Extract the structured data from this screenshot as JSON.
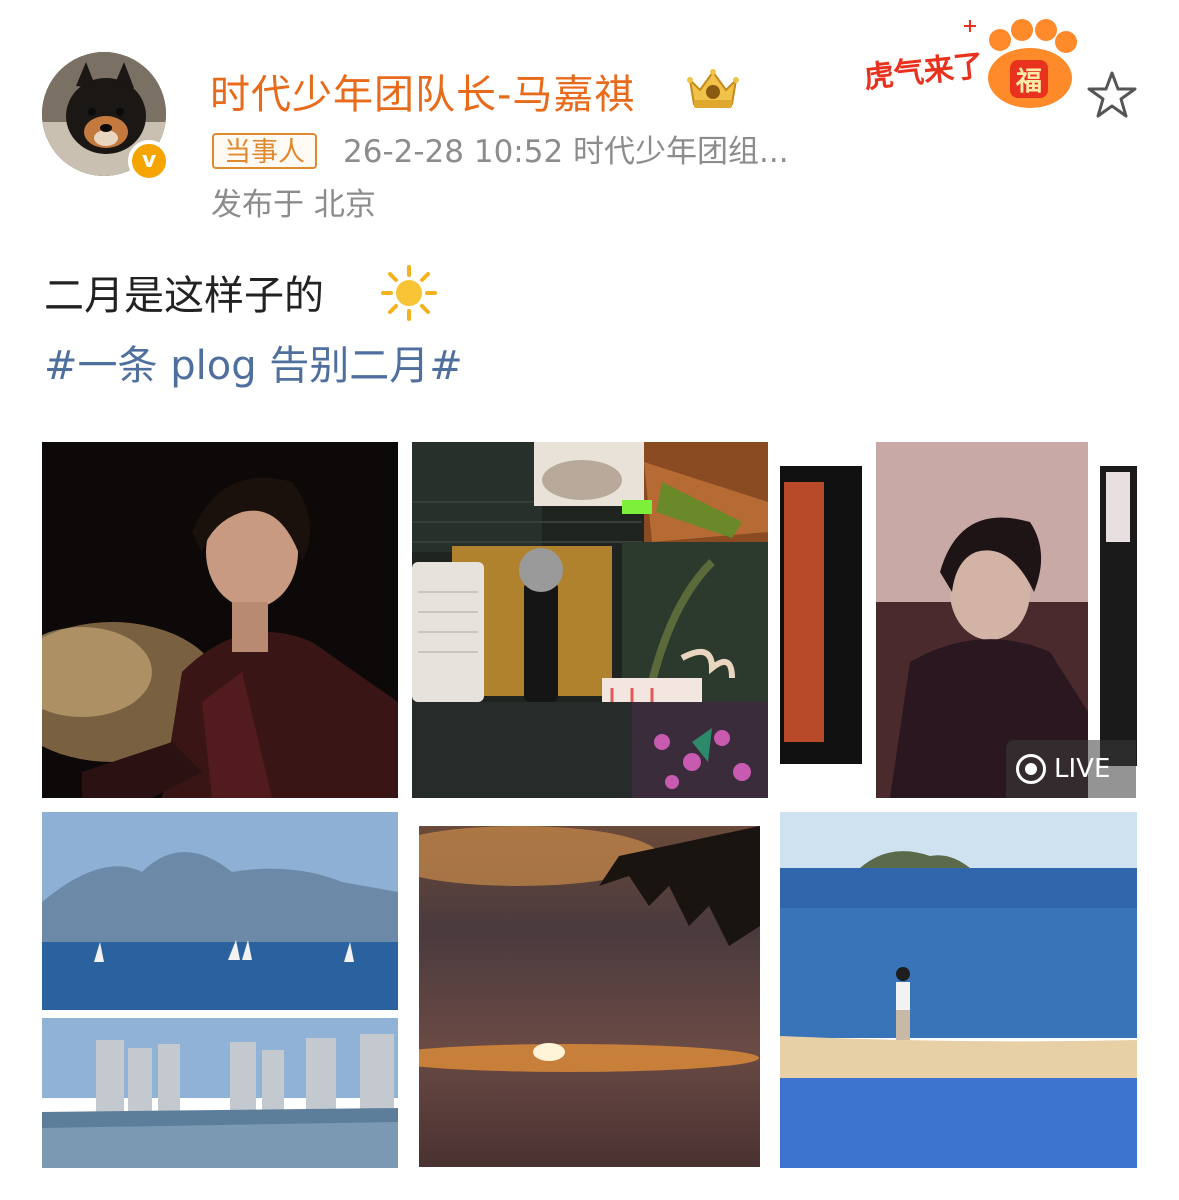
{
  "header": {
    "username": "时代少年团队长-马嘉祺",
    "verified": "v",
    "tag": "当事人",
    "meta": "26-2-28 10:52  时代少年团组...",
    "location": "发布于 北京",
    "event_badge_text": "虎气来了",
    "event_badge_char": "福"
  },
  "post": {
    "text": "二月是这样子的",
    "hashtag": "#一条 plog 告别二月#"
  },
  "grid": {
    "live_label": "LIVE",
    "photos": [
      "portrait-leather-jacket-smoke",
      "collage-food-microphone-notebook",
      "live-portrait-red-light",
      "sea-sailboats-city-skyline",
      "sunset-clouds-palm-leaf",
      "beach-person-island-sea"
    ]
  },
  "colors": {
    "username": "#e86a1b",
    "hashtag": "#4f6f9e",
    "meta": "#8c8c8c",
    "badge_orange": "#f6a400"
  }
}
